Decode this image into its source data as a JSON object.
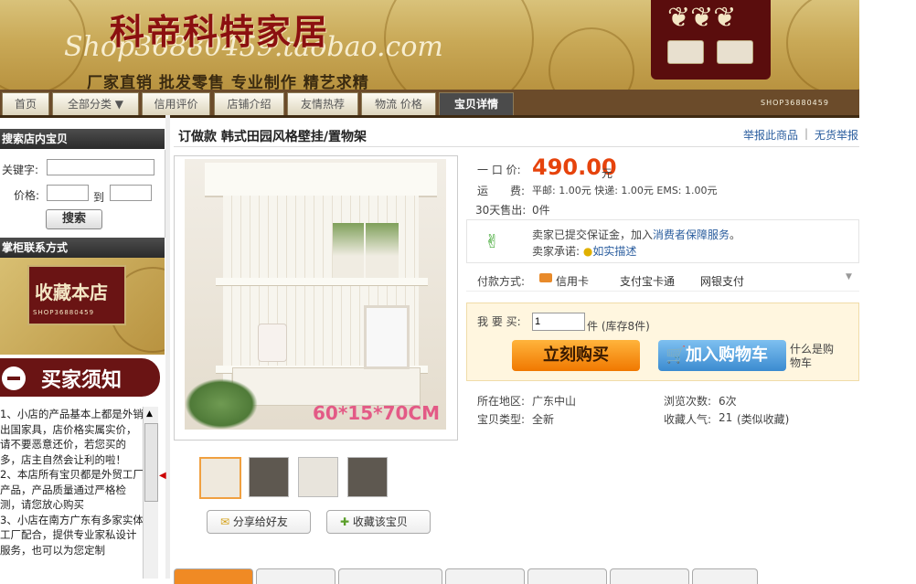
{
  "banner": {
    "title": "科帝科特家居",
    "url": "Shop36880459.taobao.com",
    "slogan": "厂家直销 批发零售 专业制作 精艺求精",
    "code": "SHOP36880459"
  },
  "nav": {
    "tabs": [
      {
        "label": "首页"
      },
      {
        "label": "全部分类 ▼"
      },
      {
        "label": "信用评价"
      },
      {
        "label": "店铺介绍"
      },
      {
        "label": "友情热荐"
      },
      {
        "label": "物流 价格"
      },
      {
        "label": "宝贝详情"
      }
    ]
  },
  "sidebar": {
    "search_heading": "搜索店内宝贝",
    "keyword_label": "关键字:",
    "price_label": "价格:",
    "to_label": "到",
    "search_button": "搜索",
    "contact_heading": "掌柜联系方式",
    "fav_shop_label": "收藏本店",
    "fav_shop_code": "SHOP36880459",
    "notice_heading": "买家须知",
    "notice_text": "1、小店的产品基本上都是外销出国家具，店价格实属实价，请不要恶意还价，若您买的多，店主自然会让利的啦！\n2、本店所有宝贝都是外贸工厂产品，产品质量通过严格检测，请您放心购买\n3、小店在南方广东有多家实体工厂配合，提供专业家私设计服务，也可以为您定制"
  },
  "product": {
    "title": "订做款 韩式田园风格壁挂/置物架",
    "report_link": "举报此商品",
    "separator": "|",
    "no_goods_link": "无货举报",
    "image_label": "60*15*70CM",
    "share_button": "分享给好友",
    "collect_button": "收藏该宝贝"
  },
  "details": {
    "price_label": "一 口 价:",
    "price": "490.00",
    "currency": "元",
    "shipping_label": "运　　费:",
    "shipping_text": "平邮: 1.00元 快递: 1.00元 EMS: 1.00元",
    "sold_label": "30天售出:",
    "sold_value": "0件",
    "promise_line1_a": "卖家已提交保证金，加入",
    "promise_line1_link": "消费者保障服务",
    "promise_line1_b": "。",
    "promise_line2_label": "卖家承诺:",
    "promise_line2_link": "如实描述",
    "payment_label": "付款方式:",
    "payment_methods": [
      "信用卡",
      "支付宝卡通",
      "网银支付"
    ],
    "buy_label": "我 要 买:",
    "quantity": "1",
    "stock_text": "件 (库存8件)",
    "buy_now": "立刻购买",
    "add_cart": "加入购物车",
    "similar_text": "什么是购物车",
    "location_label": "所在地区:",
    "location": "广东中山",
    "views_label": "浏览次数:",
    "views": "6次",
    "type_label": "宝贝类型:",
    "type": "全新",
    "fav_label": "收藏人气:",
    "fav_count": "21",
    "fav_similar": "(类似收藏)"
  },
  "colors": {
    "price": "#e6430c",
    "link": "#2a5d9e",
    "banner_gold": "#c9a957",
    "banner_red": "#8b1010"
  }
}
